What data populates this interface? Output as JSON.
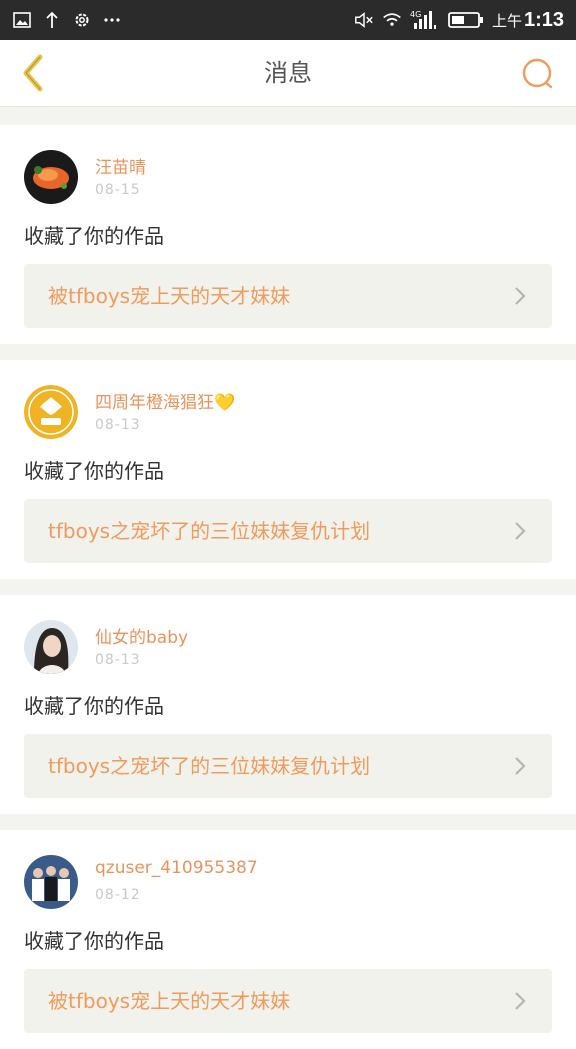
{
  "status_bar": {
    "ampm": "上午",
    "time": "1:13",
    "network": "4G"
  },
  "header": {
    "title": "消息"
  },
  "colors": {
    "accent": "#f09a5c",
    "back": "#e8c440",
    "name": "#e9945c"
  },
  "messages": [
    {
      "name": "汪苗晴",
      "date": "08-15",
      "action": "收藏了你的作品",
      "work_title": "被tfboys宠上天的天才妹妹",
      "avatar": "food-avatar"
    },
    {
      "name": "四周年橙海猖狂💛",
      "date": "08-13",
      "action": "收藏了你的作品",
      "work_title": "tfboys之宠坏了的三位妹妹复仇计划",
      "avatar": "badge-avatar"
    },
    {
      "name": "仙女的baby",
      "date": "08-13",
      "action": "收藏了你的作品",
      "work_title": "tfboys之宠坏了的三位妹妹复仇计划",
      "avatar": "girl-avatar"
    },
    {
      "name": "qzuser_410955387",
      "date": "08-12",
      "action": "收藏了你的作品",
      "work_title": "被tfboys宠上天的天才妹妹",
      "avatar": "group-avatar"
    }
  ]
}
